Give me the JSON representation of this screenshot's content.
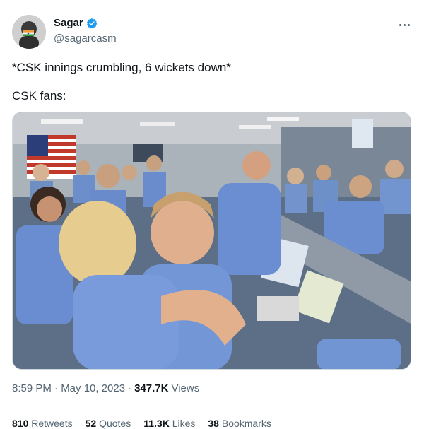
{
  "tweet": {
    "author_name": "Sagar",
    "author_handle": "@sagarcasm",
    "verified": true,
    "text_line1": "*CSK innings crumbling, 6 wickets down*",
    "text_line2": "CSK fans:",
    "timestamp": "8:59 PM · May 10, 2023",
    "separator": "·",
    "views_count": "347.7K",
    "views_label": "Views",
    "more_icon": "more-horizontal-icon",
    "verified_icon": "verified-badge-icon",
    "accent_color": "#1d9bf0"
  },
  "stats_partial": [
    {
      "count": "810",
      "label": "Retweets"
    },
    {
      "count": "52",
      "label": "Quotes"
    },
    {
      "count": "11.3K",
      "label": "Likes"
    },
    {
      "count": "38",
      "label": "Bookmarks"
    }
  ]
}
